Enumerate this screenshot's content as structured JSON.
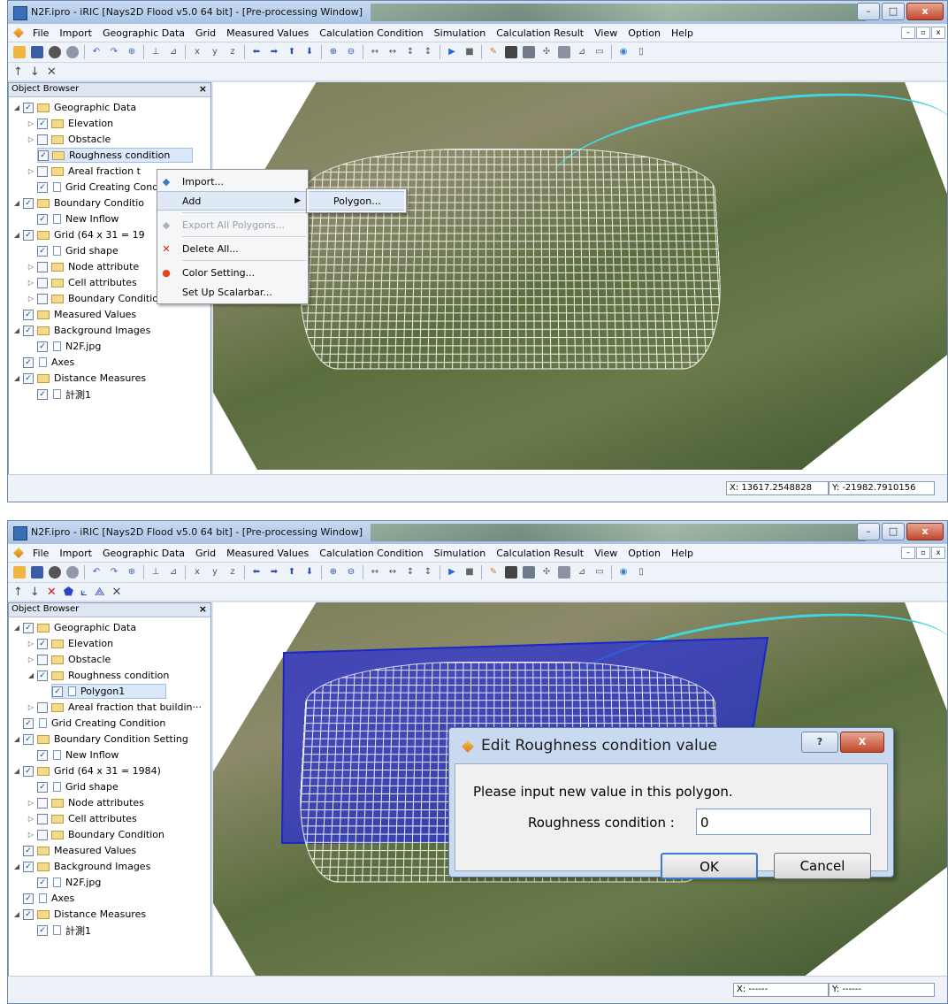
{
  "screen1": {
    "title": "N2F.ipro - iRIC [Nays2D Flood v5.0 64 bit] - [Pre-processing Window]",
    "menus": [
      "File",
      "Import",
      "Geographic Data",
      "Grid",
      "Measured Values",
      "Calculation Condition",
      "Simulation",
      "Calculation Result",
      "View",
      "Option",
      "Help"
    ],
    "browser_title": "Object Browser",
    "tree": [
      {
        "label": "Geographic Data",
        "checked": true
      },
      {
        "label": "Elevation",
        "checked": true
      },
      {
        "label": "Obstacle",
        "checked": false
      },
      {
        "label": "Roughness condition",
        "checked": true
      },
      {
        "label": "Areal fraction t",
        "checked": false
      },
      {
        "label": "Grid Creating Cond",
        "checked": true
      },
      {
        "label": "Boundary Conditio",
        "checked": true
      },
      {
        "label": "New Inflow",
        "checked": true
      },
      {
        "label": "Grid (64 x 31 = 19",
        "checked": true
      },
      {
        "label": "Grid shape",
        "checked": true
      },
      {
        "label": "Node attribute",
        "checked": false
      },
      {
        "label": "Cell attributes",
        "checked": false
      },
      {
        "label": "Boundary Condition",
        "checked": false
      },
      {
        "label": "Measured Values",
        "checked": true
      },
      {
        "label": "Background Images",
        "checked": true
      },
      {
        "label": "N2F.jpg",
        "checked": true
      },
      {
        "label": "Axes",
        "checked": true
      },
      {
        "label": "Distance Measures",
        "checked": true
      },
      {
        "label": "計測1",
        "checked": true
      }
    ],
    "context_menu": {
      "import": "Import...",
      "add": "Add",
      "export": "Export All Polygons...",
      "delete": "Delete All...",
      "color": "Color Setting...",
      "scalarbar": "Set Up Scalarbar..."
    },
    "submenu_polygon": "Polygon...",
    "coord_x": "X: 13617.2548828",
    "coord_y": "Y: -21982.7910156"
  },
  "screen2": {
    "title": "N2F.ipro - iRIC [Nays2D Flood v5.0 64 bit] - [Pre-processing Window]",
    "menus": [
      "File",
      "Import",
      "Geographic Data",
      "Grid",
      "Measured Values",
      "Calculation Condition",
      "Simulation",
      "Calculation Result",
      "View",
      "Option",
      "Help"
    ],
    "browser_title": "Object Browser",
    "tree": [
      {
        "label": "Geographic Data",
        "checked": true
      },
      {
        "label": "Elevation",
        "checked": true
      },
      {
        "label": "Obstacle",
        "checked": false
      },
      {
        "label": "Roughness condition",
        "checked": true
      },
      {
        "label": "Polygon1",
        "checked": true
      },
      {
        "label": "Areal fraction that buildin···",
        "checked": false
      },
      {
        "label": "Grid Creating Condition",
        "checked": true
      },
      {
        "label": "Boundary Condition Setting",
        "checked": true
      },
      {
        "label": "New Inflow",
        "checked": true
      },
      {
        "label": "Grid (64 x 31 = 1984)",
        "checked": true
      },
      {
        "label": "Grid shape",
        "checked": true
      },
      {
        "label": "Node attributes",
        "checked": false
      },
      {
        "label": "Cell attributes",
        "checked": false
      },
      {
        "label": "Boundary Condition",
        "checked": false
      },
      {
        "label": "Measured Values",
        "checked": true
      },
      {
        "label": "Background Images",
        "checked": true
      },
      {
        "label": "N2F.jpg",
        "checked": true
      },
      {
        "label": "Axes",
        "checked": true
      },
      {
        "label": "Distance Measures",
        "checked": true
      },
      {
        "label": "計測1",
        "checked": true
      }
    ],
    "dialog": {
      "title": "Edit Roughness condition value",
      "help": "?",
      "close": "X",
      "message": "Please input new value in this polygon.",
      "label": "Roughness condition :",
      "value": "0",
      "ok": "OK",
      "cancel": "Cancel"
    },
    "coord_x": "X: ------",
    "coord_y": "Y: ------"
  },
  "colors": {
    "polygon_fill": "#2a2fd6",
    "river": "#3fd8e0",
    "selection": "#dbe8f9"
  }
}
